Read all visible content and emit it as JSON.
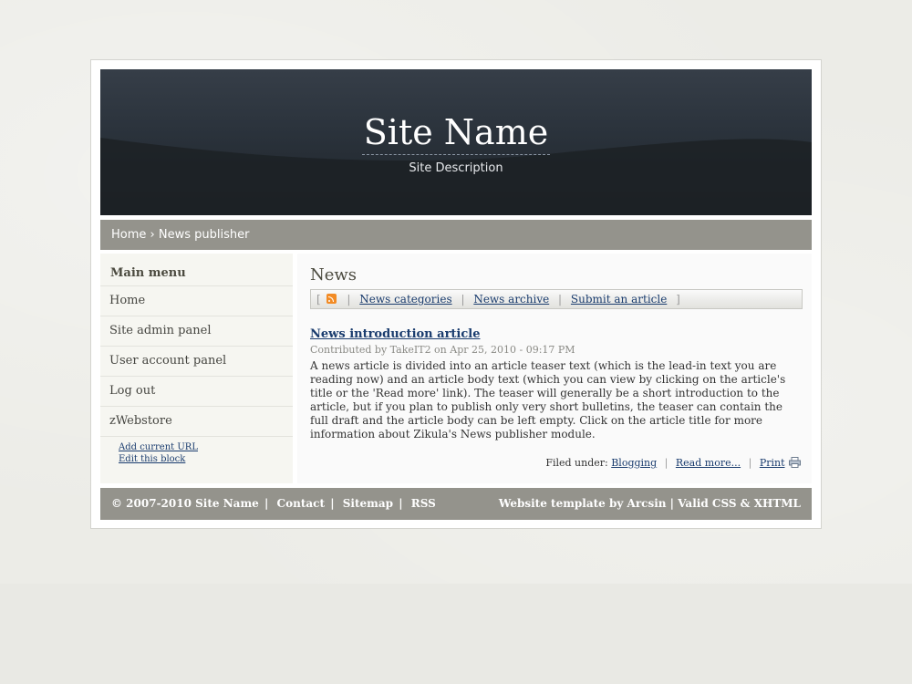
{
  "header": {
    "site_name": "Site Name",
    "site_description": "Site Description"
  },
  "breadcrumb": {
    "home": "Home",
    "separator": "›",
    "current": "News publisher"
  },
  "sidebar": {
    "title": "Main menu",
    "items": [
      {
        "label": "Home"
      },
      {
        "label": "Site admin panel"
      },
      {
        "label": "User account panel"
      },
      {
        "label": "Log out"
      },
      {
        "label": "zWebstore"
      }
    ],
    "block_links": {
      "add_url": "Add current URL",
      "edit_block": "Edit this block"
    }
  },
  "content": {
    "title": "News",
    "nav": {
      "bracket_open": "[",
      "bracket_close": "]",
      "separator": "|",
      "rss_icon": "rss-feed-icon",
      "links": [
        "News categories",
        "News archive",
        "Submit an article"
      ]
    },
    "article": {
      "title": "News introduction article",
      "meta": "Contributed by TakeIT2 on Apr 25, 2010 - 09:17 PM",
      "text": "A news article is divided into an article teaser text (which is the lead-in text you are reading now) and an article body text (which you can view by clicking on the article's title or the 'Read more' link). The teaser will generally be a short introduction to the article, but if you plan to publish only very short bulletins, the teaser can contain the full draft and the article body can be left empty. Click on the article title for more information about Zikula's News publisher module.",
      "filed_under_label": "Filed under:",
      "category": "Blogging",
      "read_more": "Read more...",
      "print": "Print",
      "print_icon": "printer-icon"
    }
  },
  "footer": {
    "copyright": "© 2007-2010 Site Name",
    "links": [
      "Contact",
      "Sitemap",
      "RSS"
    ],
    "pipe": "|",
    "right_text": "Website template by Arcsin | Valid CSS & XHTML"
  },
  "colors": {
    "page_bg": "#e9e9e4",
    "header_top": "#363e48",
    "header_bottom": "#1e2328",
    "bar_gray": "#94938c",
    "link_blue": "#1a3c6e",
    "rss_orange": "#f28b25"
  }
}
